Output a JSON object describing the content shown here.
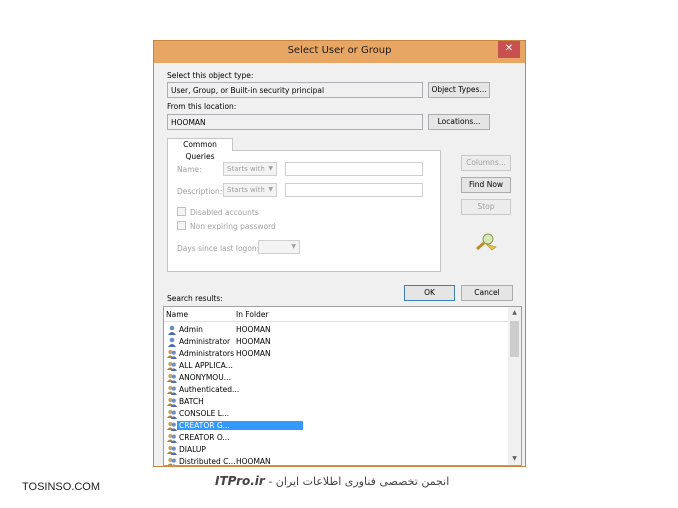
{
  "window": {
    "title": "Select User or Group",
    "close_glyph": "✕"
  },
  "object_type": {
    "label": "Select this object type:",
    "value": "User, Group, or Built-in security principal",
    "button": "Object Types..."
  },
  "location": {
    "label": "From this location:",
    "value": "HOOMAN",
    "button": "Locations..."
  },
  "tab": {
    "label": "Common Queries"
  },
  "queries": {
    "name_label": "Name:",
    "name_mode": "Starts with",
    "description_label": "Description:",
    "description_mode": "Starts with",
    "disabled_accounts": "Disabled accounts",
    "non_expiring_password": "Non expiring password",
    "days_since_logon": "Days since last logon:"
  },
  "side_buttons": {
    "columns": "Columns...",
    "find_now": "Find Now",
    "stop": "Stop"
  },
  "actions": {
    "ok": "OK",
    "cancel": "Cancel"
  },
  "results": {
    "label": "Search results:",
    "columns": [
      "Name",
      "In Folder"
    ],
    "rows": [
      {
        "name": "Admin",
        "folder": "HOOMAN",
        "icon": "user-icon"
      },
      {
        "name": "Administrator",
        "folder": "HOOMAN",
        "icon": "user-icon"
      },
      {
        "name": "Administrators",
        "folder": "HOOMAN",
        "icon": "group-icon"
      },
      {
        "name": "ALL APPLICA...",
        "folder": "",
        "icon": "group-icon"
      },
      {
        "name": "ANONYMOU...",
        "folder": "",
        "icon": "group-icon"
      },
      {
        "name": "Authenticated...",
        "folder": "",
        "icon": "group-icon"
      },
      {
        "name": "BATCH",
        "folder": "",
        "icon": "group-icon"
      },
      {
        "name": "CONSOLE L...",
        "folder": "",
        "icon": "group-icon"
      },
      {
        "name": "CREATOR G...",
        "folder": "",
        "icon": "group-icon",
        "selected": true
      },
      {
        "name": "CREATOR O...",
        "folder": "",
        "icon": "group-icon"
      },
      {
        "name": "DIALUP",
        "folder": "",
        "icon": "group-icon"
      },
      {
        "name": "Distributed C...",
        "folder": "HOOMAN",
        "icon": "group-icon"
      }
    ]
  },
  "colors": {
    "titlebar": "#e8a665",
    "selection": "#3399ff",
    "close": "#c75050"
  },
  "footer": {
    "left": "TOSINSO.COM",
    "brand": "ITPro.ir",
    "right_text": " - انجمن تخصصی فناوری اطلاعات ایران"
  }
}
